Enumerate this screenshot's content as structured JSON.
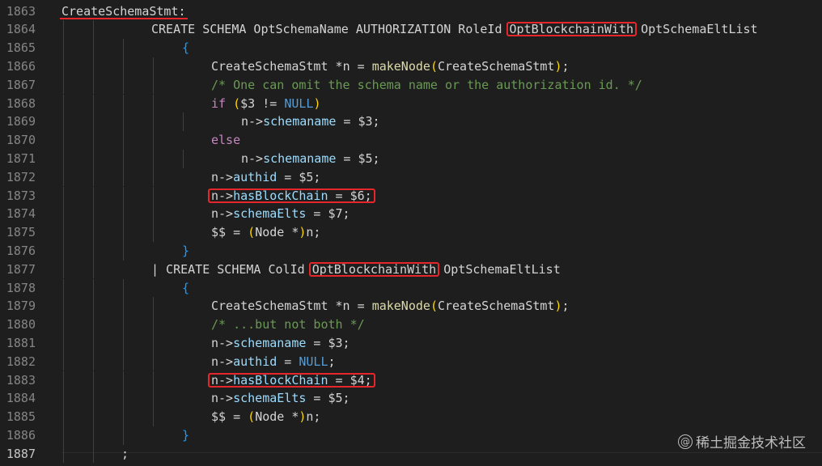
{
  "editor": {
    "lines": [
      {
        "num": "1863",
        "tokens": [
          {
            "t": "CreateSchemaStmt:",
            "c": "plain"
          }
        ]
      },
      {
        "num": "1864",
        "tokens": [
          {
            "t": "CREATE SCHEMA OptSchemaName AUTHORIZATION RoleId ",
            "c": "plain"
          },
          {
            "t": "OptBlockchainWith",
            "c": "plain"
          },
          {
            "t": " OptSchemaEltList",
            "c": "plain"
          }
        ]
      },
      {
        "num": "1865",
        "tokens": [
          {
            "t": "{",
            "c": "brace"
          }
        ]
      },
      {
        "num": "1866",
        "tokens": [
          {
            "t": "CreateSchemaStmt ",
            "c": "plain"
          },
          {
            "t": "*",
            "c": "plain"
          },
          {
            "t": "n = ",
            "c": "plain"
          },
          {
            "t": "makeNode",
            "c": "fn"
          },
          {
            "t": "(",
            "c": "paren"
          },
          {
            "t": "CreateSchemaStmt",
            "c": "plain"
          },
          {
            "t": ")",
            "c": "paren"
          },
          {
            "t": ";",
            "c": "plain"
          }
        ]
      },
      {
        "num": "1867",
        "tokens": [
          {
            "t": "/* One can omit the schema name or the authorization id. */",
            "c": "cmt"
          }
        ]
      },
      {
        "num": "1868",
        "tokens": [
          {
            "t": "if",
            "c": "kw"
          },
          {
            "t": " (",
            "c": "paren"
          },
          {
            "t": "$3 != ",
            "c": "plain"
          },
          {
            "t": "NULL",
            "c": "kw2"
          },
          {
            "t": ")",
            "c": "paren"
          }
        ]
      },
      {
        "num": "1869",
        "tokens": [
          {
            "t": "n->",
            "c": "plain"
          },
          {
            "t": "schemaname",
            "c": "var"
          },
          {
            "t": " = $3;",
            "c": "plain"
          }
        ]
      },
      {
        "num": "1870",
        "tokens": [
          {
            "t": "else",
            "c": "kw"
          }
        ]
      },
      {
        "num": "1871",
        "tokens": [
          {
            "t": "n->",
            "c": "plain"
          },
          {
            "t": "schemaname",
            "c": "var"
          },
          {
            "t": " = $5;",
            "c": "plain"
          }
        ]
      },
      {
        "num": "1872",
        "tokens": [
          {
            "t": "n->",
            "c": "plain"
          },
          {
            "t": "authid",
            "c": "var"
          },
          {
            "t": " = $5;",
            "c": "plain"
          }
        ]
      },
      {
        "num": "1873",
        "tokens": [
          {
            "t": "n->",
            "c": "plain"
          },
          {
            "t": "hasBlockChain",
            "c": "var"
          },
          {
            "t": " = $6;",
            "c": "plain"
          }
        ]
      },
      {
        "num": "1874",
        "tokens": [
          {
            "t": "n->",
            "c": "plain"
          },
          {
            "t": "schemaElts",
            "c": "var"
          },
          {
            "t": " = $7;",
            "c": "plain"
          }
        ]
      },
      {
        "num": "1875",
        "tokens": [
          {
            "t": "$$ = ",
            "c": "plain"
          },
          {
            "t": "(",
            "c": "paren"
          },
          {
            "t": "Node *",
            "c": "plain"
          },
          {
            "t": ")",
            "c": "paren"
          },
          {
            "t": "n;",
            "c": "plain"
          }
        ]
      },
      {
        "num": "1876",
        "tokens": [
          {
            "t": "}",
            "c": "brace"
          }
        ]
      },
      {
        "num": "1877",
        "tokens": [
          {
            "t": "| CREATE SCHEMA ColId ",
            "c": "plain"
          },
          {
            "t": "OptBlockchainWith",
            "c": "plain"
          },
          {
            "t": " OptSchemaEltList",
            "c": "plain"
          }
        ]
      },
      {
        "num": "1878",
        "tokens": [
          {
            "t": "{",
            "c": "brace"
          }
        ]
      },
      {
        "num": "1879",
        "tokens": [
          {
            "t": "CreateSchemaStmt *n = ",
            "c": "plain"
          },
          {
            "t": "makeNode",
            "c": "fn"
          },
          {
            "t": "(",
            "c": "paren"
          },
          {
            "t": "CreateSchemaStmt",
            "c": "plain"
          },
          {
            "t": ")",
            "c": "paren"
          },
          {
            "t": ";",
            "c": "plain"
          }
        ]
      },
      {
        "num": "1880",
        "tokens": [
          {
            "t": "/* ...but not both */",
            "c": "cmt"
          }
        ]
      },
      {
        "num": "1881",
        "tokens": [
          {
            "t": "n->",
            "c": "plain"
          },
          {
            "t": "schemaname",
            "c": "var"
          },
          {
            "t": " = $3;",
            "c": "plain"
          }
        ]
      },
      {
        "num": "1882",
        "tokens": [
          {
            "t": "n->",
            "c": "plain"
          },
          {
            "t": "authid",
            "c": "var"
          },
          {
            "t": " = ",
            "c": "plain"
          },
          {
            "t": "NULL",
            "c": "kw2"
          },
          {
            "t": ";",
            "c": "plain"
          }
        ]
      },
      {
        "num": "1883",
        "tokens": [
          {
            "t": "n->",
            "c": "plain"
          },
          {
            "t": "hasBlockChain",
            "c": "var"
          },
          {
            "t": " = $4;",
            "c": "plain"
          }
        ]
      },
      {
        "num": "1884",
        "tokens": [
          {
            "t": "n->",
            "c": "plain"
          },
          {
            "t": "schemaElts",
            "c": "var"
          },
          {
            "t": " = $5;",
            "c": "plain"
          }
        ]
      },
      {
        "num": "1885",
        "tokens": [
          {
            "t": "$$ = ",
            "c": "plain"
          },
          {
            "t": "(",
            "c": "paren"
          },
          {
            "t": "Node *",
            "c": "plain"
          },
          {
            "t": ")",
            "c": "paren"
          },
          {
            "t": "n;",
            "c": "plain"
          }
        ]
      },
      {
        "num": "1886",
        "tokens": [
          {
            "t": "}",
            "c": "brace"
          }
        ]
      },
      {
        "num": "1887",
        "tokens": [
          {
            "t": ";",
            "c": "plain"
          }
        ]
      }
    ],
    "active_line": "1887"
  },
  "watermark": {
    "icon": "at-sign-icon",
    "icon_glyph": "@",
    "text": "稀土掘金技术社区"
  },
  "colors": {
    "background": "#1e1e1e",
    "highlight_box": "#e5262a",
    "keyword": "#c586c0",
    "comment": "#6a9955",
    "function": "#dcdcaa",
    "variable": "#9cdcfe",
    "constant": "#569cd6"
  }
}
